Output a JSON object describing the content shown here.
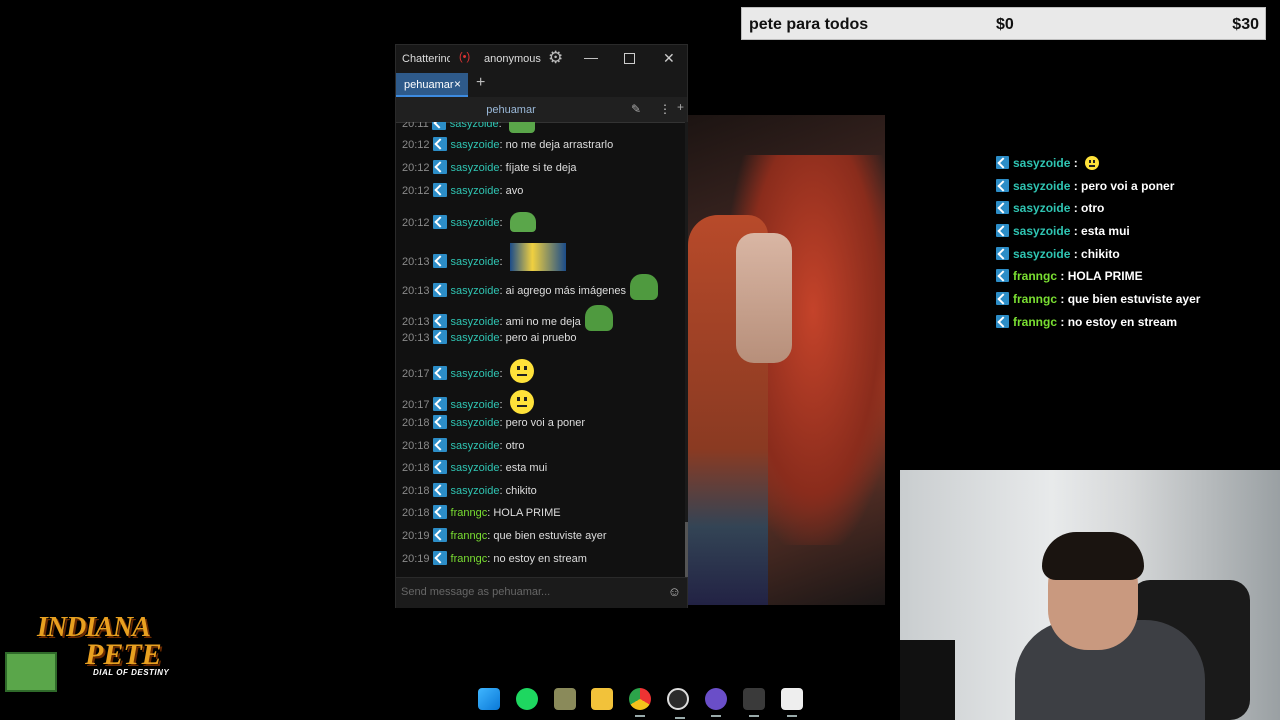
{
  "goal": {
    "title": "pete para todos",
    "start": "$0",
    "end": "$30"
  },
  "overlay_chat": [
    {
      "user": "sasyzoide",
      "text": "",
      "emote": "smile",
      "color": "#2fc4b2"
    },
    {
      "user": "sasyzoide",
      "text": "pero voi a poner",
      "color": "#2fc4b2"
    },
    {
      "user": "sasyzoide",
      "text": "otro",
      "color": "#2fc4b2"
    },
    {
      "user": "sasyzoide",
      "text": "esta mui",
      "color": "#2fc4b2"
    },
    {
      "user": "sasyzoide",
      "text": "chikito",
      "color": "#2fc4b2"
    },
    {
      "user": "franngc",
      "text": "HOLA PRIME",
      "color": "#7adf32"
    },
    {
      "user": "franngc",
      "text": "que bien estuviste ayer",
      "color": "#7adf32"
    },
    {
      "user": "franngc",
      "text": "no estoy en stream",
      "color": "#7adf32"
    }
  ],
  "window": {
    "app_title": "Chatterino",
    "live_icon": "broadcast-icon",
    "account": "anonymous",
    "tab_name": "pehuamar",
    "tab_close": "×",
    "add_tab": "+",
    "channel_name": "pehuamar",
    "input_placeholder": "Send message as pehuamar..."
  },
  "messages": [
    {
      "time": "20:11",
      "user": "sasyzoide",
      "text": "",
      "emote": "pepe"
    },
    {
      "time": "20:12",
      "user": "sasyzoide",
      "text": "no me deja arrastrarlo"
    },
    {
      "time": "20:12",
      "user": "sasyzoide",
      "text": "fíjate si te deja"
    },
    {
      "time": "20:12",
      "user": "sasyzoide",
      "text": "avo"
    },
    {
      "time": "20:12",
      "user": "sasyzoide",
      "text": "",
      "emote": "pepe"
    },
    {
      "time": "20:13",
      "user": "sasyzoide",
      "text": "",
      "emote": "img"
    },
    {
      "time": "20:13",
      "user": "sasyzoide",
      "text": "ai agrego más imágenes",
      "emote": "pepe2"
    },
    {
      "time": "20:13",
      "user": "sasyzoide",
      "text": "ami no me deja",
      "emote": "pepe2"
    },
    {
      "time": "20:13",
      "user": "sasyzoide",
      "text": "pero ai pruebo"
    },
    {
      "time": "20:17",
      "user": "sasyzoide",
      "text": "",
      "emote": "smile"
    },
    {
      "time": "20:17",
      "user": "sasyzoide",
      "text": "",
      "emote": "smile"
    },
    {
      "time": "20:18",
      "user": "sasyzoide",
      "text": "pero voi a poner"
    },
    {
      "time": "20:18",
      "user": "sasyzoide",
      "text": "otro"
    },
    {
      "time": "20:18",
      "user": "sasyzoide",
      "text": "esta mui"
    },
    {
      "time": "20:18",
      "user": "sasyzoide",
      "text": "chikito"
    },
    {
      "time": "20:18",
      "user": "franngc",
      "text": "HOLA PRIME"
    },
    {
      "time": "20:19",
      "user": "franngc",
      "text": "que bien estuviste ayer"
    },
    {
      "time": "20:19",
      "user": "franngc",
      "text": "no estoy en stream"
    }
  ],
  "user_colors": {
    "sasyzoide": "#2fc4b2",
    "franngc": "#7adf32"
  },
  "logo": {
    "line1": "INDIANA",
    "line2": "PETE",
    "line3": "DIAL OF DESTINY"
  },
  "taskbar": [
    {
      "name": "windows-start-icon"
    },
    {
      "name": "spotify-icon"
    },
    {
      "name": "game-app-icon"
    },
    {
      "name": "file-explorer-icon"
    },
    {
      "name": "chrome-icon"
    },
    {
      "name": "obs-icon"
    },
    {
      "name": "chat-app-icon"
    },
    {
      "name": "chatterino-icon"
    },
    {
      "name": "store-icon"
    }
  ]
}
